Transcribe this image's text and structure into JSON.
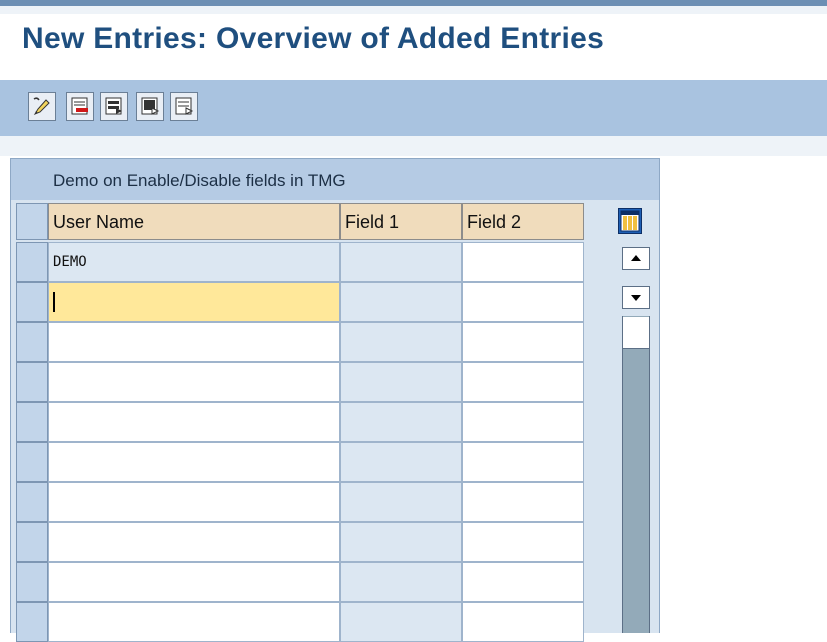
{
  "header": {
    "title": "New Entries: Overview of Added Entries"
  },
  "toolbar": {
    "buttons": [
      {
        "name": "change-display-icon"
      },
      {
        "name": "delete-row-icon"
      },
      {
        "name": "select-all-icon"
      },
      {
        "name": "select-block-icon"
      },
      {
        "name": "deselect-all-icon"
      }
    ]
  },
  "table": {
    "title": "Demo on Enable/Disable fields in TMG",
    "columns": [
      "User Name",
      "Field 1",
      "Field 2"
    ],
    "rows": [
      {
        "user_name": "DEMO",
        "field1": "",
        "field2": ""
      },
      {
        "user_name": "",
        "field1": "",
        "field2": ""
      },
      {
        "user_name": "",
        "field1": "",
        "field2": ""
      },
      {
        "user_name": "",
        "field1": "",
        "field2": ""
      },
      {
        "user_name": "",
        "field1": "",
        "field2": ""
      },
      {
        "user_name": "",
        "field1": "",
        "field2": ""
      },
      {
        "user_name": "",
        "field1": "",
        "field2": ""
      },
      {
        "user_name": "",
        "field1": "",
        "field2": ""
      },
      {
        "user_name": "",
        "field1": "",
        "field2": ""
      },
      {
        "user_name": "",
        "field1": "",
        "field2": ""
      }
    ]
  },
  "colors": {
    "title": "#1f4f7f",
    "toolbar_bg": "#a9c3e0",
    "header_cell_bg": "#f0dcbc",
    "focus_cell_bg": "#ffe89a",
    "disabled_cell_bg": "#dce7f2"
  }
}
